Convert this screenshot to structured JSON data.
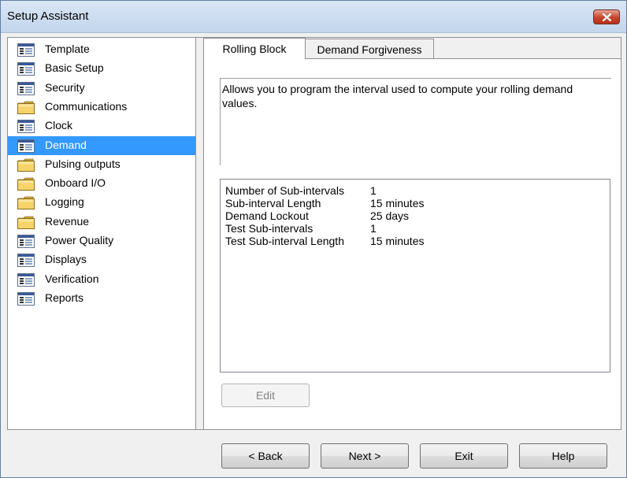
{
  "window": {
    "title": "Setup Assistant"
  },
  "tree": {
    "items": [
      {
        "label": "Template",
        "icon": "form-icon",
        "selected": false
      },
      {
        "label": "Basic Setup",
        "icon": "form-icon",
        "selected": false
      },
      {
        "label": "Security",
        "icon": "form-icon",
        "selected": false
      },
      {
        "label": "Communications",
        "icon": "folder-icon",
        "selected": false
      },
      {
        "label": "Clock",
        "icon": "form-icon",
        "selected": false
      },
      {
        "label": "Demand",
        "icon": "form-icon",
        "selected": true
      },
      {
        "label": "Pulsing outputs",
        "icon": "folder-icon",
        "selected": false
      },
      {
        "label": "Onboard I/O",
        "icon": "folder-icon",
        "selected": false
      },
      {
        "label": "Logging",
        "icon": "folder-icon",
        "selected": false
      },
      {
        "label": "Revenue",
        "icon": "folder-icon",
        "selected": false
      },
      {
        "label": "Power Quality",
        "icon": "form-icon",
        "selected": false
      },
      {
        "label": "Displays",
        "icon": "form-icon",
        "selected": false
      },
      {
        "label": "Verification",
        "icon": "form-icon",
        "selected": false
      },
      {
        "label": "Reports",
        "icon": "form-icon",
        "selected": false
      }
    ]
  },
  "tabs": [
    {
      "label": "Rolling Block",
      "active": true
    },
    {
      "label": "Demand Forgiveness",
      "active": false
    }
  ],
  "description": "Allows you to program the interval used to compute your rolling demand values.",
  "settings": [
    {
      "name": "Number of Sub-intervals",
      "value": "1"
    },
    {
      "name": "Sub-interval Length",
      "value": "15 minutes"
    },
    {
      "name": "Demand Lockout",
      "value": "25 days"
    },
    {
      "name": "Test Sub-intervals",
      "value": "1"
    },
    {
      "name": "Test Sub-interval Length",
      "value": "15 minutes"
    }
  ],
  "edit_label": "Edit",
  "footer": {
    "back_label": "< Back",
    "next_label": "Next >",
    "exit_label": "Exit",
    "help_label": "Help"
  },
  "colors": {
    "selection": "#3399ff",
    "close_button": "#c6452c"
  }
}
